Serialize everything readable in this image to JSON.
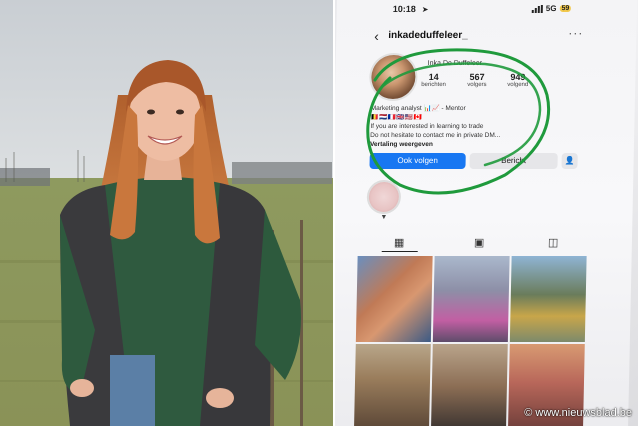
{
  "phone": {
    "status_time": "10:18",
    "network": "5G",
    "battery": "59",
    "username": "inkadeduffeleer_",
    "profile_name_small": "Inka De Duffeleer",
    "stats": [
      {
        "value": "14",
        "label": "berichten"
      },
      {
        "value": "567",
        "label": "volgers"
      },
      {
        "value": "949",
        "label": "volgend"
      }
    ],
    "bio_lines": [
      "Marketing analyst 📊📈 - Mentor",
      "🇧🇪🇳🇱🇫🇷🇬🇧🇺🇸🇨🇦",
      "If you are interested in learning to trade",
      "Do not hesitate to contact me in private DM..."
    ],
    "bio_more": "Vertaling weergeven",
    "follow_label": "Ook volgen",
    "message_label": "Bericht"
  },
  "watermark": "© www.nieuwsblad.be"
}
